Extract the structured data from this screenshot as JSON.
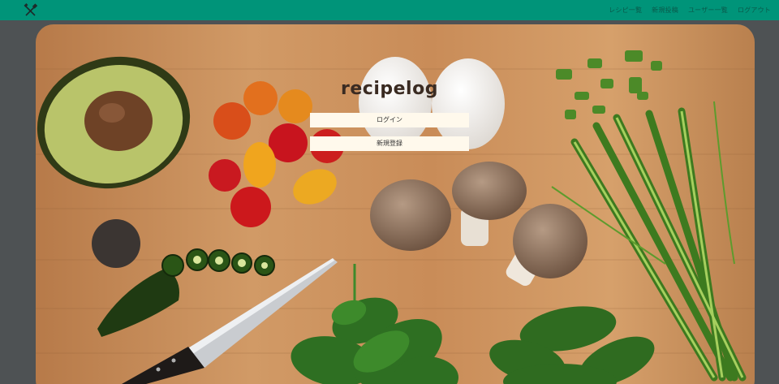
{
  "app": {
    "title": "recipelog"
  },
  "header": {
    "logo_icon": "fork-knife-icon",
    "nav": [
      {
        "label": "レシピ一覧"
      },
      {
        "label": "新規投稿"
      },
      {
        "label": "ユーザー一覧"
      },
      {
        "label": "ログアウト"
      }
    ]
  },
  "hero": {
    "login_label": "ログイン",
    "signup_label": "新規登録"
  },
  "colors": {
    "header_bg": "#009479",
    "button_bg": "#fff9ec",
    "board": "#c98f5a"
  }
}
